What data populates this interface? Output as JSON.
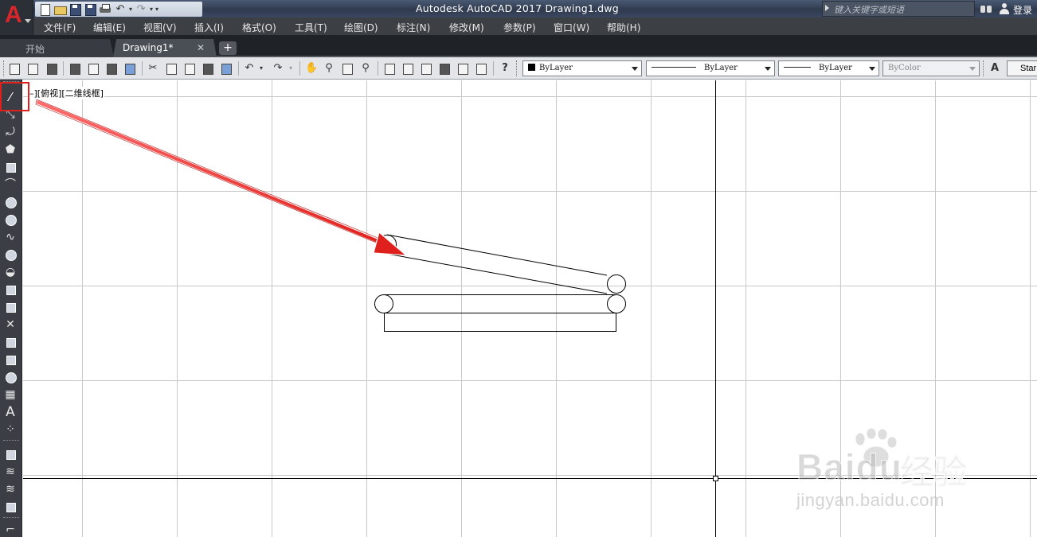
{
  "app": {
    "logo_letter": "A",
    "title": "Autodesk AutoCAD 2017    Drawing1.dwg",
    "search_placeholder": "键入关键字或短语",
    "login": "登录"
  },
  "menu": [
    "文件(F)",
    "编辑(E)",
    "视图(V)",
    "插入(I)",
    "格式(O)",
    "工具(T)",
    "绘图(D)",
    "标注(N)",
    "修改(M)",
    "参数(P)",
    "窗口(W)",
    "帮助(H)"
  ],
  "tabs": {
    "start": "开始",
    "drawing": "Drawing1*",
    "close_glyph": "✕",
    "add_glyph": "+"
  },
  "toolbar": {
    "color_combo": "ByLayer",
    "linetype_combo": "ByLayer",
    "lineweight_combo": "ByLayer",
    "plotstyle_combo": "ByColor",
    "style_button": "Star"
  },
  "viewport_label": "–][俯视][二维线框]",
  "watermark": {
    "brand": "Bai",
    "brand_suffix": "du",
    "product": "经验",
    "url": "jingyan.baidu.com"
  },
  "colors": {
    "accent_red": "#e0201c",
    "grid": "#c8c8c8",
    "axis": "#000000"
  },
  "icons": {
    "left_toolbar": [
      "line-icon",
      "construction-line-icon",
      "polyline-icon",
      "polygon-icon",
      "rectangle-icon",
      "arc-icon",
      "circle-icon",
      "revision-cloud-icon",
      "spline-icon",
      "ellipse-icon",
      "ellipse-arc-icon",
      "insert-block-icon",
      "make-block-icon",
      "point-icon",
      "hatch-icon",
      "gradient-icon",
      "region-icon",
      "table-icon",
      "multiline-text-icon",
      "add-selected-icon"
    ]
  }
}
